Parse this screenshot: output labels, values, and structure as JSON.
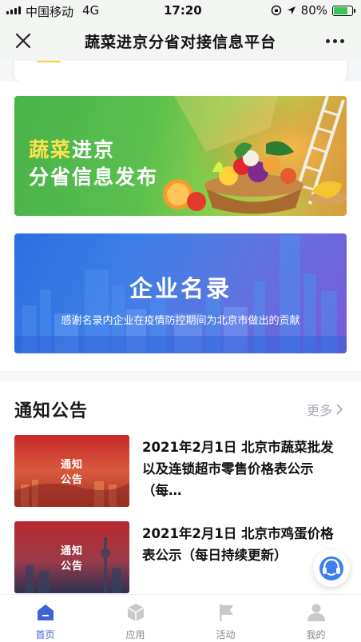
{
  "status_bar": {
    "carrier": "中国移动",
    "network": "4G",
    "time": "17:20",
    "battery": "80%",
    "battery_level": 0.8
  },
  "nav": {
    "title": "蔬菜进京分省对接信息平台",
    "close_icon": "close-icon",
    "more_icon": "more-dots-icon"
  },
  "banners": {
    "veg": {
      "title_highlight": "蔬菜",
      "title_rest": "进京",
      "subtitle": "分省信息发布"
    },
    "company": {
      "title": "企业名录",
      "subtitle": "感谢名录内企业在疫情防控期间为北京市做出的贡献"
    }
  },
  "notices": {
    "title": "通知公告",
    "more": "更多",
    "items": [
      {
        "thumb_label": "通知\n公告",
        "text": "2021年2月1日 北京市蔬菜批发以及连锁超市零售价格表公示（每…"
      },
      {
        "thumb_label": "通知\n公告",
        "text": "2021年2月1日 北京市鸡蛋价格表公示（每日持续更新）"
      }
    ]
  },
  "tabs": [
    {
      "label": "首页",
      "icon": "home-icon",
      "active": true
    },
    {
      "label": "应用",
      "icon": "apps-cube-icon",
      "active": false
    },
    {
      "label": "活动",
      "icon": "flag-icon",
      "active": false
    },
    {
      "label": "我的",
      "icon": "profile-icon",
      "active": false
    }
  ],
  "colors": {
    "accent": "#3b64d8",
    "veg_green": "#4cb54b",
    "company_blue": "#3f7ee6"
  }
}
